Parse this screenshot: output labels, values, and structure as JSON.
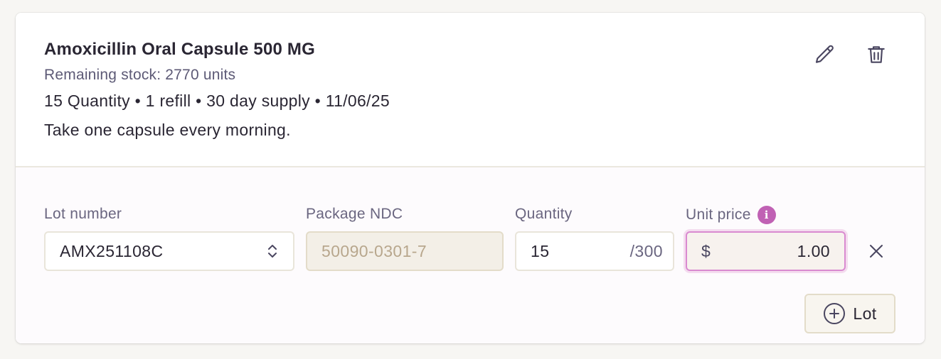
{
  "medication": {
    "name": "Amoxicillin Oral Capsule 500 MG",
    "remaining_stock": "Remaining stock: 2770 units",
    "details": "15 Quantity • 1 refill • 30 day supply • 11/06/25",
    "instructions": "Take one capsule every morning."
  },
  "actions": {
    "edit_icon": "pencil-icon",
    "delete_icon": "trash-icon"
  },
  "lot_row": {
    "lot_number_label": "Lot number",
    "lot_number_value": "AMX251108C",
    "package_ndc_label": "Package NDC",
    "package_ndc_value": "50090-0301-7",
    "quantity_label": "Quantity",
    "quantity_value": "15",
    "quantity_max": "/300",
    "unit_price_label": "Unit price",
    "info_icon_glyph": "i",
    "currency_symbol": "$",
    "unit_price_value": "1.00"
  },
  "add_lot_label": "Lot",
  "colors": {
    "accent": "#c061b4",
    "text": "#2a2633",
    "muted": "#6a6680",
    "border": "#e9e5da"
  }
}
